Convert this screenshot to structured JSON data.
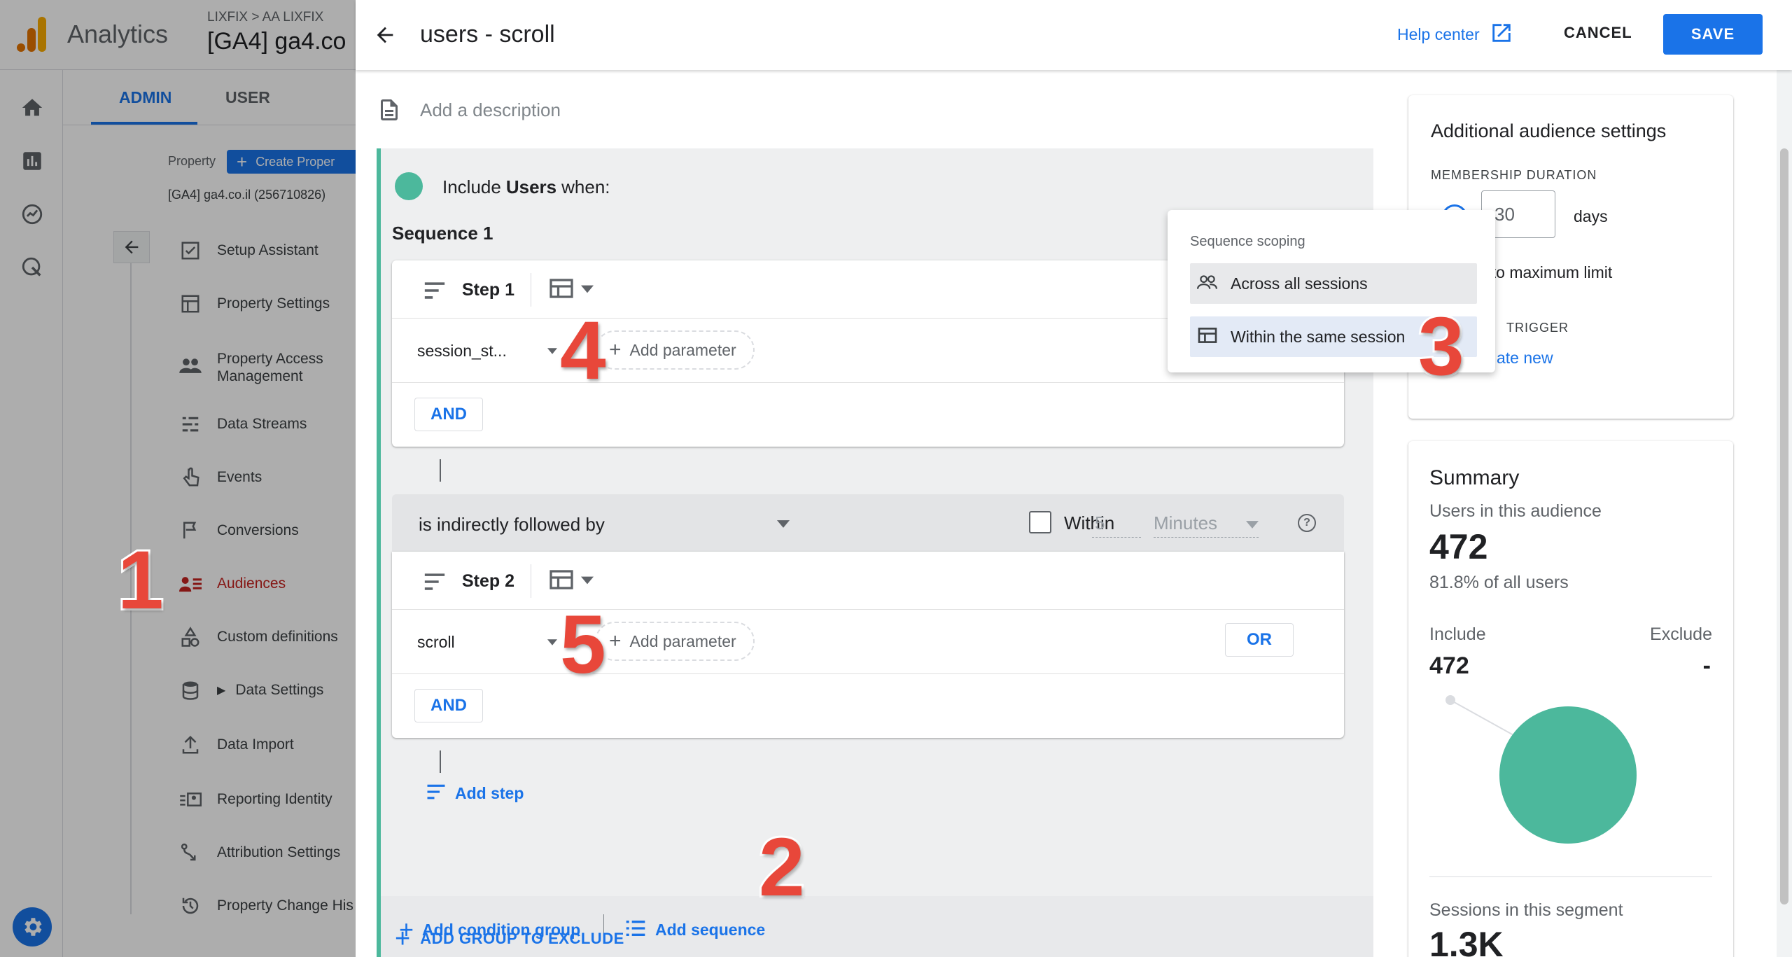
{
  "app": {
    "name": "Analytics",
    "breadcrumb": "LIXFIX > AA LIXFIX",
    "property_title": "[GA4] ga4.co"
  },
  "admin": {
    "tabs": [
      {
        "label": "ADMIN"
      },
      {
        "label": "USER"
      }
    ],
    "property_label": "Property",
    "create_property": "Create Proper",
    "property_name": "[GA4] ga4.co.il (256710826)",
    "nav": [
      {
        "label": "Setup Assistant",
        "icon": "checkbox-icon"
      },
      {
        "label": "Property Settings",
        "icon": "settings-box-icon"
      },
      {
        "label": "Property Access Management",
        "icon": "people-icon"
      },
      {
        "label": "Data Streams",
        "icon": "streams-icon"
      },
      {
        "label": "Events",
        "icon": "touch-icon"
      },
      {
        "label": "Conversions",
        "icon": "flag-icon"
      },
      {
        "label": "Audiences",
        "icon": "audiences-icon"
      },
      {
        "label": "Custom definitions",
        "icon": "shapes-icon"
      },
      {
        "label": "Data Settings",
        "icon": "database-icon"
      },
      {
        "label": "Data Import",
        "icon": "upload-icon"
      },
      {
        "label": "Reporting Identity",
        "icon": "identity-icon"
      },
      {
        "label": "Attribution Settings",
        "icon": "attribution-icon"
      },
      {
        "label": "Property Change His",
        "icon": "history-icon"
      }
    ]
  },
  "dialog": {
    "title": "users - scroll",
    "help_center": "Help center",
    "cancel": "CANCEL",
    "save": "SAVE",
    "description_placeholder": "Add a description",
    "include_prefix": "Include",
    "include_subject": "Users",
    "include_suffix": "when:",
    "sequence_title": "Sequence 1",
    "steps": [
      {
        "title": "Step 1",
        "event": "session_st...",
        "add_parameter": "Add parameter",
        "and": "AND"
      },
      {
        "title": "Step 2",
        "event": "scroll",
        "add_parameter": "Add parameter",
        "and": "AND",
        "or": "OR"
      }
    ],
    "followed_by": "is indirectly followed by",
    "within_label": "Within",
    "within_value": "5",
    "within_unit": "Minutes",
    "add_step": "Add step",
    "add_condition_group": "Add condition group",
    "add_sequence": "Add sequence",
    "add_group_to_exclude": "ADD GROUP TO EXCLUDE"
  },
  "scoping_menu": {
    "header": "Sequence scoping",
    "options": [
      {
        "label": "Across all sessions",
        "selected": false
      },
      {
        "label": "Within the same session",
        "selected": true
      }
    ]
  },
  "settings": {
    "title": "Additional audience settings",
    "membership_label": "MEMBERSHIP DURATION",
    "duration_value": "30",
    "duration_unit": "days",
    "max_limit_partial": "t to maximum limit",
    "trigger_partial": "TRIGGER",
    "create_new_partial": "ate new"
  },
  "summary": {
    "title": "Summary",
    "users_label": "Users in this audience",
    "users_value": "472",
    "users_pct": "81.8% of all users",
    "include_label": "Include",
    "exclude_label": "Exclude",
    "include_value": "472",
    "exclude_value": "-",
    "sessions_label": "Sessions in this segment",
    "sessions_value": "1.3K"
  },
  "annotations": [
    "1",
    "2",
    "3",
    "4",
    "5"
  ],
  "colors": {
    "accent": "#1a73e8",
    "include_dot": "#4cb89c",
    "annotation": "#e8473a",
    "sidebar_active": "#c5221f"
  }
}
